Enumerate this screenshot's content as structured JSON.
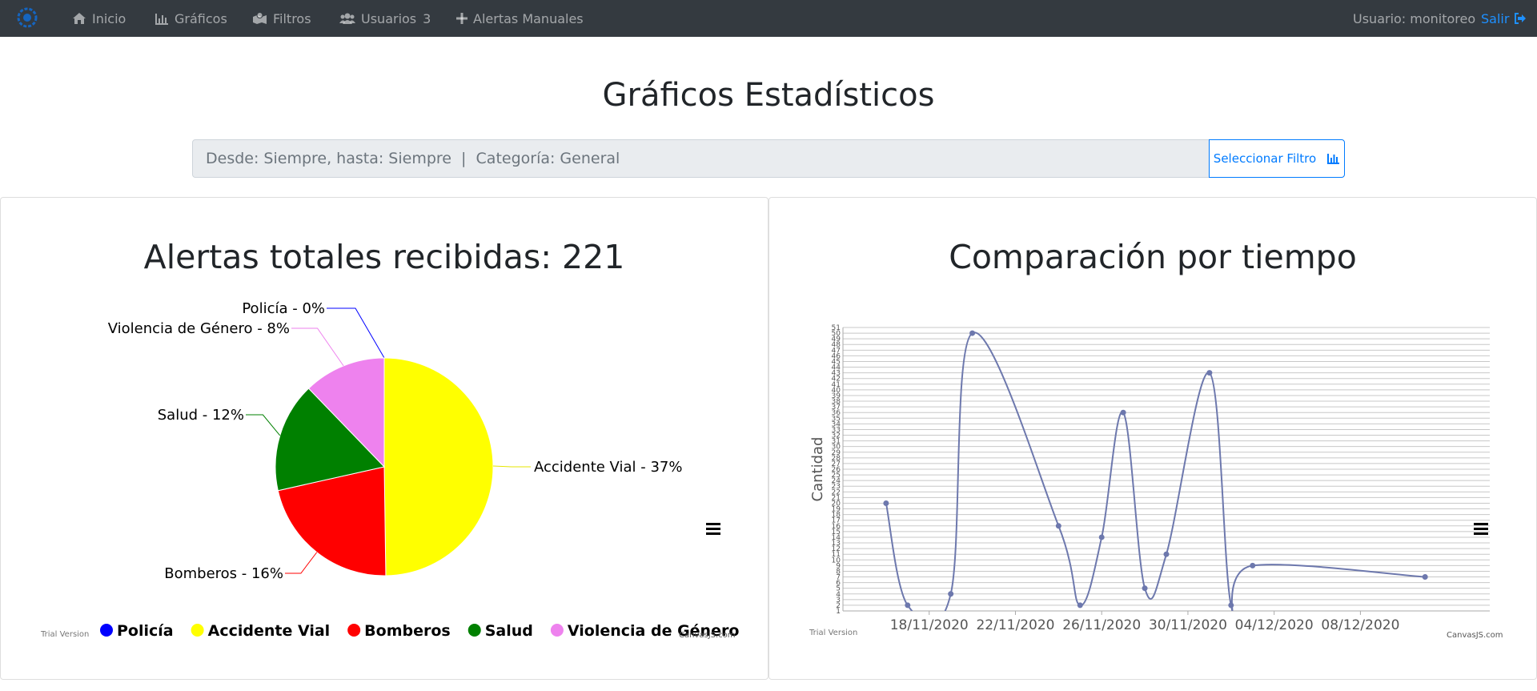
{
  "nav": {
    "items": [
      {
        "label": "Inicio",
        "icon": "home-icon"
      },
      {
        "label": "Gráficos",
        "icon": "bar-chart-icon"
      },
      {
        "label": "Filtros",
        "icon": "map-marked-icon"
      },
      {
        "label": "Usuarios",
        "icon": "users-icon",
        "badge": "3"
      },
      {
        "label": "Alertas Manuales",
        "icon": "plus-icon"
      }
    ],
    "user": "Usuario: monitoreo",
    "logout": "Salir",
    "logout_color": "#1e90ff"
  },
  "page_title": "Gráficos Estadísticos",
  "filter": {
    "text": "Desde: Siempre, hasta: Siempre  |  Categoría: General",
    "button": "Seleccionar Filtro"
  },
  "pie_card": {
    "title": "Alertas totales recibidas: 221",
    "trial": "Trial Version",
    "credit": "CanvasJS.com"
  },
  "line_card": {
    "title": "Comparación por tiempo",
    "trial": "Trial Version",
    "credit": "CanvasJS.com"
  },
  "chart_data": [
    {
      "type": "pie",
      "title": "Alertas totales recibidas: 221",
      "slices": [
        {
          "name": "Policía",
          "label": "Policía - 0%",
          "value": 0,
          "color": "#0000ff"
        },
        {
          "name": "Accidente Vial",
          "label": "Accidente Vial - 37%",
          "value": 110,
          "color": "#ffff00"
        },
        {
          "name": "Bomberos",
          "label": "Bomberos - 16%",
          "value": 48,
          "color": "#ff0000"
        },
        {
          "name": "Salud",
          "label": "Salud - 12%",
          "value": 36,
          "color": "#008000"
        },
        {
          "name": "Violencia de Género",
          "label": "Violencia de Género - 8%",
          "value": 27,
          "color": "#ee82ee"
        }
      ],
      "legend": [
        "Policía",
        "Accidente Vial",
        "Bomberos",
        "Salud",
        "Violencia de Género"
      ],
      "legend_placement": "bottom"
    },
    {
      "type": "line",
      "title": "Comparación por tiempo",
      "ylabel": "Cantidad",
      "xlabel": "",
      "x_ticks": [
        "18/11/2020",
        "22/11/2020",
        "26/11/2020",
        "30/11/2020",
        "04/12/2020",
        "08/12/2020"
      ],
      "y_ticks": [
        1,
        2,
        3,
        4,
        5,
        6,
        7,
        8,
        9,
        10,
        11,
        12,
        13,
        14,
        15,
        16,
        17,
        18,
        19,
        20,
        21,
        22,
        23,
        24,
        25,
        26,
        27,
        28,
        29,
        30,
        31,
        32,
        33,
        34,
        35,
        36,
        37,
        38,
        39,
        40,
        41,
        42,
        43,
        44,
        45,
        46,
        47,
        48,
        49,
        50,
        51
      ],
      "ylim": [
        1,
        51
      ],
      "grid": true,
      "line_color": "#6d78ad",
      "series": [
        {
          "points": [
            {
              "x": "2020-11-16",
              "y": 20
            },
            {
              "x": "2020-11-17",
              "y": 2
            },
            {
              "x": "2020-11-19",
              "y": 4
            },
            {
              "x": "2020-11-20",
              "y": 50
            },
            {
              "x": "2020-11-24",
              "y": 16
            },
            {
              "x": "2020-11-25",
              "y": 2
            },
            {
              "x": "2020-11-26",
              "y": 14
            },
            {
              "x": "2020-11-27",
              "y": 36
            },
            {
              "x": "2020-11-28",
              "y": 5
            },
            {
              "x": "2020-11-29",
              "y": 11
            },
            {
              "x": "2020-12-01",
              "y": 43
            },
            {
              "x": "2020-12-02",
              "y": 2
            },
            {
              "x": "2020-12-03",
              "y": 9
            },
            {
              "x": "2020-12-11",
              "y": 7
            }
          ]
        }
      ]
    }
  ]
}
